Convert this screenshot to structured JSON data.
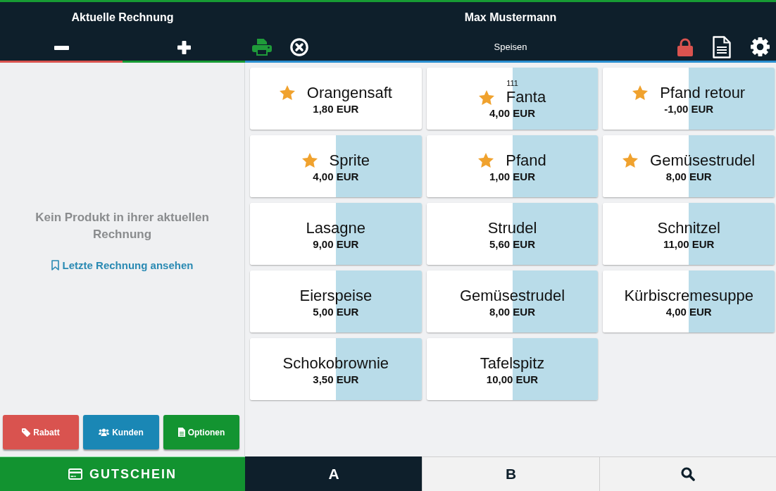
{
  "header": {
    "bill_title": "Aktuelle Rechnung",
    "user_name": "Max Mustermann",
    "category": "Speisen"
  },
  "left_panel": {
    "empty_message": "Kein Produkt in ihrer aktuellen Rechnung",
    "last_bill_link": "Letzte Rechnung ansehen"
  },
  "actions": [
    {
      "kind": "discount",
      "label": "Rabatt"
    },
    {
      "kind": "customers",
      "label": "Kunden"
    },
    {
      "kind": "options",
      "label": "Optionen"
    }
  ],
  "products": [
    {
      "name": "Orangensaft",
      "price": "1,80 EUR",
      "favorite": true,
      "highlighted": false
    },
    {
      "name": "Fanta",
      "price": "4,00 EUR",
      "favorite": true,
      "highlighted": true,
      "badge": "111"
    },
    {
      "name": "Pfand retour",
      "price": "-1,00 EUR",
      "favorite": true,
      "highlighted": true
    },
    {
      "name": "Sprite",
      "price": "4,00 EUR",
      "favorite": true,
      "highlighted": true
    },
    {
      "name": "Pfand",
      "price": "1,00 EUR",
      "favorite": true,
      "highlighted": true
    },
    {
      "name": "Gemüsestrudel",
      "price": "8,00 EUR",
      "favorite": true,
      "highlighted": true
    },
    {
      "name": "Lasagne",
      "price": "9,00 EUR",
      "favorite": false,
      "highlighted": true
    },
    {
      "name": "Strudel",
      "price": "5,60 EUR",
      "favorite": false,
      "highlighted": true
    },
    {
      "name": "Schnitzel",
      "price": "11,00 EUR",
      "favorite": false,
      "highlighted": true
    },
    {
      "name": "Eierspeise",
      "price": "5,00 EUR",
      "favorite": false,
      "highlighted": true
    },
    {
      "name": "Gemüsestrudel",
      "price": "8,00 EUR",
      "favorite": false,
      "highlighted": true
    },
    {
      "name": "Kürbiscremesuppe",
      "price": "4,00 EUR",
      "favorite": false,
      "highlighted": true
    },
    {
      "name": "Schokobrownie",
      "price": "3,50 EUR",
      "favorite": false,
      "highlighted": true
    },
    {
      "name": "Tafelspitz",
      "price": "10,00 EUR",
      "favorite": false,
      "highlighted": true
    }
  ],
  "voucher_button": {
    "label": "GUTSCHEIN"
  },
  "bottom_tabs": [
    {
      "kind": "letter",
      "label": "A",
      "selected": true
    },
    {
      "kind": "letter",
      "label": "B",
      "selected": false
    },
    {
      "kind": "search",
      "selected": false
    }
  ]
}
